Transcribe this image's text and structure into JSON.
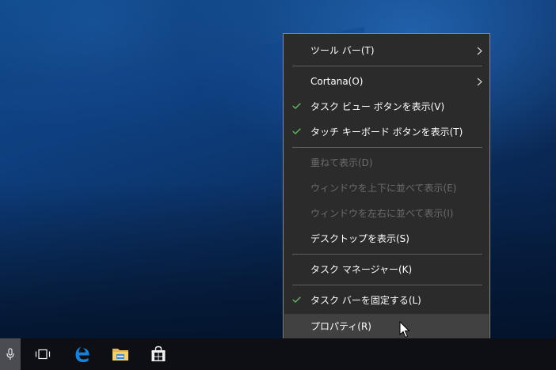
{
  "menu": {
    "items": [
      {
        "label": "ツール バー(T)",
        "checked": false,
        "disabled": false,
        "submenu": true
      },
      {
        "label": "Cortana(O)",
        "checked": false,
        "disabled": false,
        "submenu": true
      },
      {
        "label": "タスク ビュー ボタンを表示(V)",
        "checked": true,
        "disabled": false,
        "submenu": false
      },
      {
        "label": "タッチ キーボード ボタンを表示(T)",
        "checked": true,
        "disabled": false,
        "submenu": false
      },
      {
        "label": "重ねて表示(D)",
        "checked": false,
        "disabled": true,
        "submenu": false
      },
      {
        "label": "ウィンドウを上下に並べて表示(E)",
        "checked": false,
        "disabled": true,
        "submenu": false
      },
      {
        "label": "ウィンドウを左右に並べて表示(I)",
        "checked": false,
        "disabled": true,
        "submenu": false
      },
      {
        "label": "デスクトップを表示(S)",
        "checked": false,
        "disabled": false,
        "submenu": false
      },
      {
        "label": "タスク マネージャー(K)",
        "checked": false,
        "disabled": false,
        "submenu": false
      },
      {
        "label": "タスク バーを固定する(L)",
        "checked": true,
        "disabled": false,
        "submenu": false
      },
      {
        "label": "プロパティ(R)",
        "checked": false,
        "disabled": false,
        "submenu": false,
        "hovered": true
      }
    ]
  },
  "taskbar": {
    "icons": [
      "microphone-icon",
      "task-view-icon",
      "edge-icon",
      "file-explorer-icon",
      "store-icon"
    ]
  },
  "colors": {
    "menu_bg": "#2b2b2b",
    "menu_hover": "#414141",
    "check_green": "#5fb85f",
    "disabled_text": "#6c6c6c",
    "edge_blue": "#1a80d6",
    "taskbar_bg": "#0d0f14"
  }
}
